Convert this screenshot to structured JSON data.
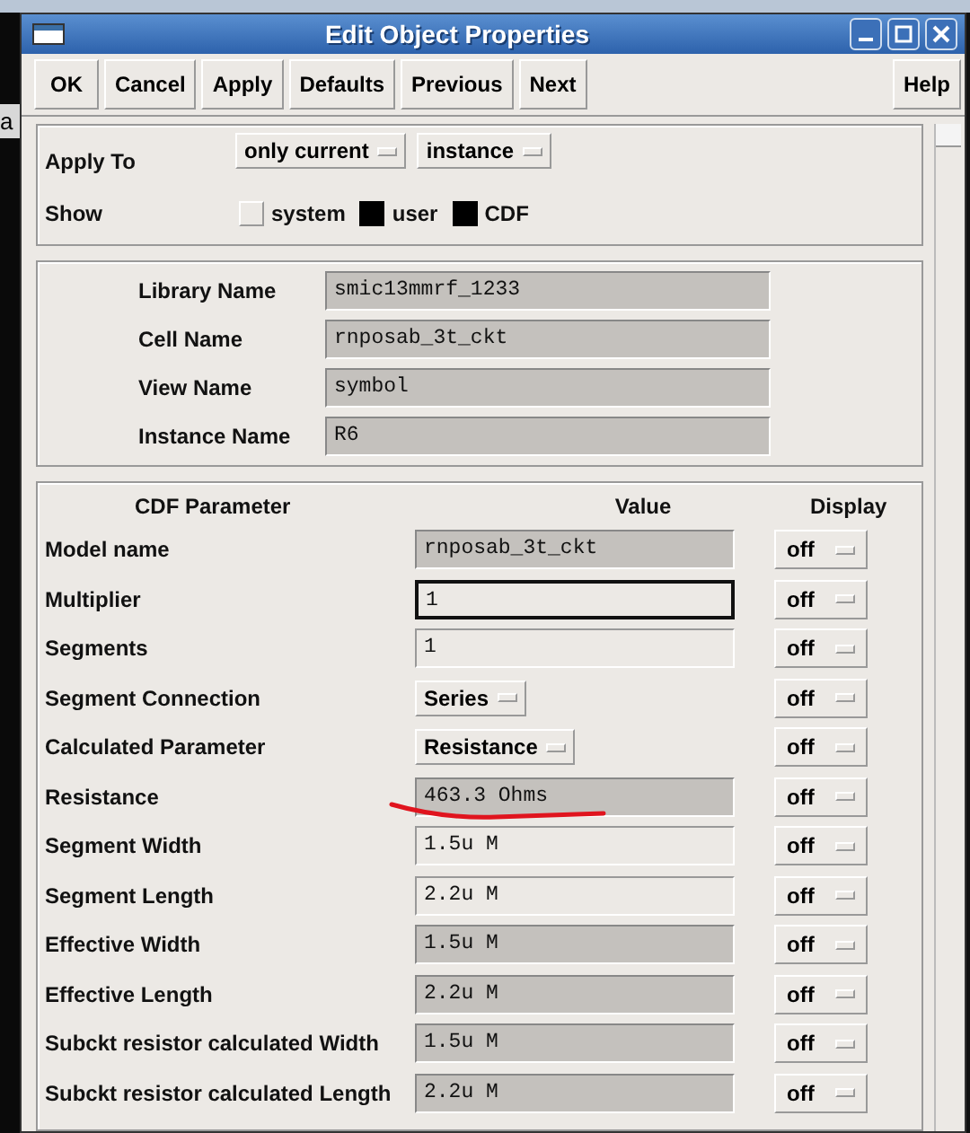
{
  "background_app": {
    "text": "a"
  },
  "window": {
    "title": "Edit Object Properties"
  },
  "buttons": [
    "OK",
    "Cancel",
    "Apply",
    "Defaults",
    "Previous",
    "Next"
  ],
  "help_button": "Help",
  "apply_to": {
    "label": "Apply To",
    "menus": [
      "only current",
      "instance"
    ]
  },
  "show": {
    "label": "Show",
    "options": [
      {
        "label": "system",
        "checked": false
      },
      {
        "label": "user",
        "checked": true
      },
      {
        "label": "CDF",
        "checked": true
      }
    ]
  },
  "identity": [
    {
      "label": "Library Name",
      "value": "smic13mmrf_1233"
    },
    {
      "label": "Cell Name",
      "value": "rnposab_3t_ckt"
    },
    {
      "label": "View Name",
      "value": "symbol"
    },
    {
      "label": "Instance Name",
      "value": "R6"
    }
  ],
  "cdf": {
    "columns": [
      "CDF Parameter",
      "Value",
      "Display"
    ],
    "rows": [
      {
        "name": "Model name",
        "kind": "field",
        "value": "rnposab_3t_ckt",
        "editable": false,
        "focused": false,
        "display": "off"
      },
      {
        "name": "Multiplier",
        "kind": "field",
        "value": "1",
        "editable": true,
        "focused": true,
        "display": "off"
      },
      {
        "name": "Segments",
        "kind": "field",
        "value": "1",
        "editable": true,
        "focused": false,
        "display": "off"
      },
      {
        "name": "Segment Connection",
        "kind": "menu",
        "value": "Series",
        "display": "off"
      },
      {
        "name": "Calculated Parameter",
        "kind": "menu",
        "value": "Resistance",
        "display": "off"
      },
      {
        "name": "Resistance",
        "kind": "field",
        "value": "463.3 Ohms",
        "editable": false,
        "focused": false,
        "display": "off",
        "annotated": true
      },
      {
        "name": "Segment Width",
        "kind": "field",
        "value": "1.5u M",
        "editable": true,
        "focused": false,
        "display": "off"
      },
      {
        "name": "Segment Length",
        "kind": "field",
        "value": "2.2u M",
        "editable": true,
        "focused": false,
        "display": "off"
      },
      {
        "name": "Effective Width",
        "kind": "field",
        "value": "1.5u M",
        "editable": false,
        "focused": false,
        "display": "off"
      },
      {
        "name": "Effective Length",
        "kind": "field",
        "value": "2.2u M",
        "editable": false,
        "focused": false,
        "display": "off"
      },
      {
        "name": "Subckt resistor calculated Width",
        "kind": "field",
        "value": "1.5u M",
        "editable": false,
        "focused": false,
        "display": "off"
      },
      {
        "name": "Subckt resistor calculated Length",
        "kind": "field",
        "value": "2.2u M",
        "editable": false,
        "focused": false,
        "display": "off"
      }
    ]
  }
}
